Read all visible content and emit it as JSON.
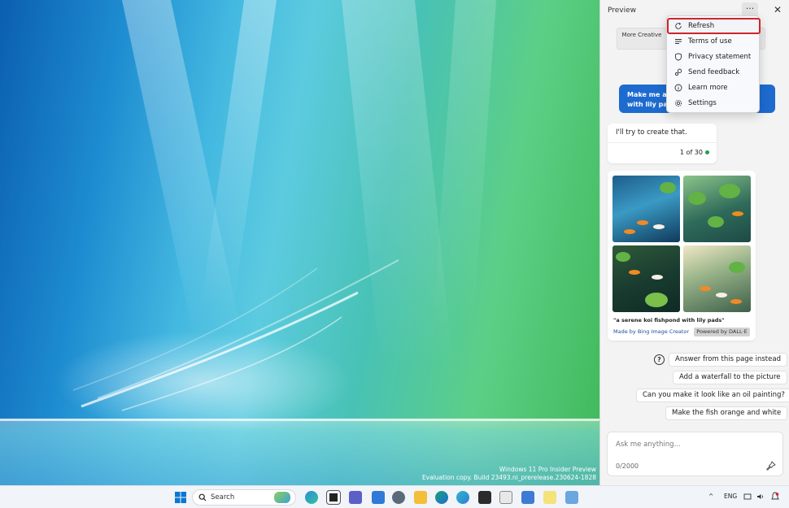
{
  "desktop": {
    "watermark_line1": "Windows 11 Pro Insider Preview",
    "watermark_line2": "Evaluation copy. Build 23493.ni_prerelease.230624-1828"
  },
  "panel": {
    "title": "Preview",
    "more_label": "···",
    "close_label": "✕",
    "style_chip_label": "More Creative",
    "user_message": "Make me a p... with lily pads",
    "user_message_line1": "Make me a p",
    "user_message_line2": "with lily pads",
    "bot_reply": "I'll try to create that.",
    "bot_count": "1 of 30",
    "image_caption": "\"a serene koi fishpond with lily pads\"",
    "image_credit": "Made by Bing Image Creator",
    "powered_by": "Powered by DALL·E",
    "suggestions": [
      "Answer from this page instead",
      "Add a waterfall to the picture",
      "Can you make it look like an oil painting?",
      "Make the fish orange and white"
    ],
    "input_placeholder": "Ask me anything...",
    "char_count": "0/2000"
  },
  "menu": {
    "items": [
      {
        "label": "Refresh",
        "icon": "refresh-icon",
        "highlighted": true
      },
      {
        "label": "Terms of use",
        "icon": "lines-icon"
      },
      {
        "label": "Privacy statement",
        "icon": "shield-icon"
      },
      {
        "label": "Send feedback",
        "icon": "feedback-icon"
      },
      {
        "label": "Learn more",
        "icon": "info-icon"
      },
      {
        "label": "Settings",
        "icon": "gear-icon"
      }
    ]
  },
  "taskbar": {
    "search_label": "Search",
    "language": "ENG",
    "highlight_color": "#d1242b",
    "accent_color": "#1d6bcf"
  }
}
